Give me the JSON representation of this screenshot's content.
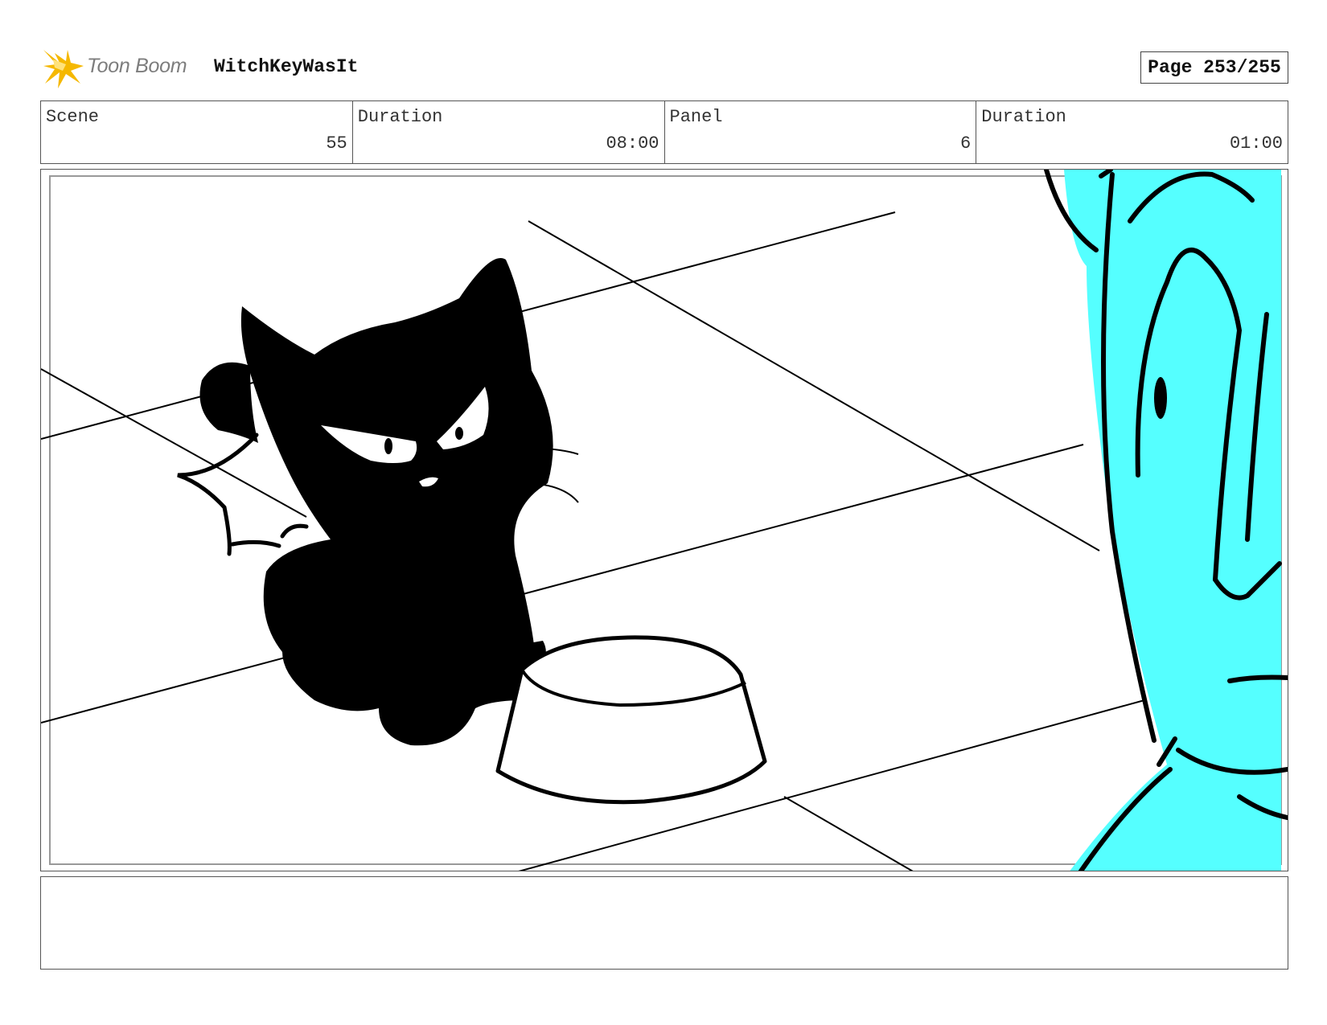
{
  "header": {
    "logo_text": "Toon Boom",
    "project_title": "WitchKeyWasIt",
    "page_label": "Page 253/255"
  },
  "info": {
    "scene_label": "Scene",
    "scene_value": "55",
    "scene_duration_label": "Duration",
    "scene_duration_value": "08:00",
    "panel_label": "Panel",
    "panel_value": "6",
    "panel_duration_label": "Duration",
    "panel_duration_value": "01:00"
  },
  "colors": {
    "logo_star": "#f5b800",
    "character_fill": "#55ffff",
    "ink": "#000000"
  },
  "notes": ""
}
